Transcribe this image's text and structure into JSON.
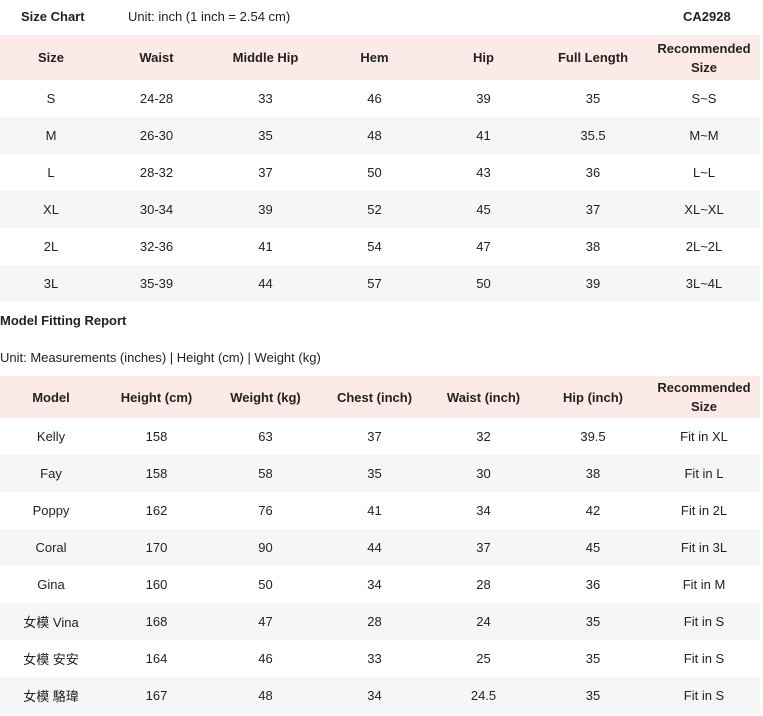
{
  "size_chart": {
    "title": "Size Chart",
    "unit": "Unit: inch (1 inch = 2.54 cm)",
    "code": "CA2928",
    "headers": [
      "Size",
      "Waist",
      "Middle Hip",
      "Hem",
      "Hip",
      "Full Length",
      "Recommended Size"
    ],
    "rows": [
      [
        "S",
        "24-28",
        "33",
        "46",
        "39",
        "35",
        "S~S"
      ],
      [
        "M",
        "26-30",
        "35",
        "48",
        "41",
        "35.5",
        "M~M"
      ],
      [
        "L",
        "28-32",
        "37",
        "50",
        "43",
        "36",
        "L~L"
      ],
      [
        "XL",
        "30-34",
        "39",
        "52",
        "45",
        "37",
        "XL~XL"
      ],
      [
        "2L",
        "32-36",
        "41",
        "54",
        "47",
        "38",
        "2L~2L"
      ],
      [
        "3L",
        "35-39",
        "44",
        "57",
        "50",
        "39",
        "3L~4L"
      ]
    ]
  },
  "fitting_report": {
    "title": "Model Fitting Report",
    "unit": "Unit: Measurements (inches) | Height (cm) | Weight (kg)",
    "headers": [
      "Model",
      "Height (cm)",
      "Weight (kg)",
      "Chest (inch)",
      "Waist (inch)",
      "Hip (inch)",
      "Recommended Size"
    ],
    "rows": [
      [
        "Kelly",
        "158",
        "63",
        "37",
        "32",
        "39.5",
        "Fit in XL"
      ],
      [
        "Fay",
        "158",
        "58",
        "35",
        "30",
        "38",
        "Fit in L"
      ],
      [
        "Poppy",
        "162",
        "76",
        "41",
        "34",
        "42",
        "Fit in 2L"
      ],
      [
        "Coral",
        "170",
        "90",
        "44",
        "37",
        "45",
        "Fit in 3L"
      ],
      [
        "Gina",
        "160",
        "50",
        "34",
        "28",
        "36",
        "Fit in M"
      ],
      [
        "女模 Vina",
        "168",
        "47",
        "28",
        "24",
        "35",
        "Fit in S"
      ],
      [
        "女模 安安",
        "164",
        "46",
        "33",
        "25",
        "35",
        "Fit in S"
      ],
      [
        "女模 駱瑋",
        "167",
        "48",
        "34",
        "24.5",
        "35",
        "Fit in S"
      ]
    ]
  },
  "colors": {
    "header_bg": "#fbeae6",
    "stripe_bg": "#f5f7f7",
    "text": "#222222"
  }
}
